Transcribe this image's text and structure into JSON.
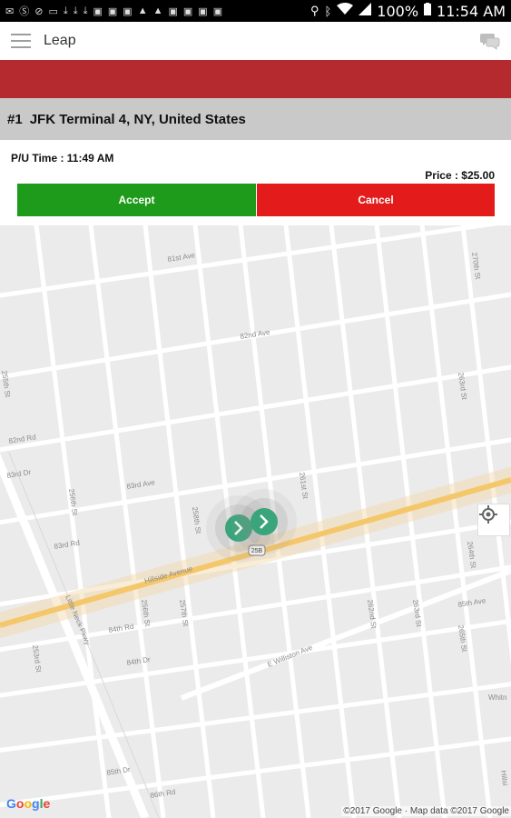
{
  "status_bar": {
    "battery": "100%",
    "time": "11:54 AM",
    "icons_left": [
      "mail-icon",
      "skype-icon",
      "block-icon",
      "voicemail-icon",
      "download-icon",
      "download-icon",
      "download-icon",
      "image-icon",
      "image-icon",
      "image-icon",
      "warning-icon",
      "warning-icon",
      "image-icon",
      "image-icon",
      "image-icon",
      "image-icon"
    ],
    "icons_right": [
      "location-icon",
      "bluetooth-icon",
      "wifi-icon",
      "signal-icon",
      "battery-icon"
    ]
  },
  "app_bar": {
    "title": "Leap"
  },
  "trip": {
    "number": "#1",
    "location": "JFK Terminal 4, NY, United States",
    "pickup_time": "P/U Time : 11:49 AM",
    "price": "Price : $25.00",
    "accept_label": "Accept",
    "cancel_label": "Cancel"
  },
  "colors": {
    "red_band": "#b52a2f",
    "accept": "#1e9b1a",
    "cancel": "#e31b1b",
    "marker": "#3aa57a"
  },
  "map": {
    "streets": {
      "s1": "81st Ave",
      "s2": "82nd Ave",
      "s3": "82nd Rd",
      "s4": "83rd Ave",
      "s5": "83rd Dr",
      "s6": "83rd Rd",
      "s7": "Hillside Avenue",
      "s8": "Little Neck Pkwy",
      "s9": "84th Rd",
      "s10": "84th Dr",
      "s11": "85th Dr",
      "s12": "E Williston Ave",
      "s13": "85th Ave",
      "s14": "86th Rd",
      "s15": "256th St",
      "s16": "258th St",
      "s17": "257th St",
      "s18": "256th St",
      "s19": "261st St",
      "s20": "263rd St",
      "s21": "264th St",
      "s22": "262nd St",
      "s23": "263rd St",
      "s24": "265th St",
      "s25": "253rd St",
      "s26": "255th St",
      "s27": "270th St",
      "s28": "Whitn",
      "s29": "Hillsi"
    },
    "route_shield": "25B",
    "google": "Google",
    "attribution": "©2017 Google · Map data ©2017 Google"
  }
}
